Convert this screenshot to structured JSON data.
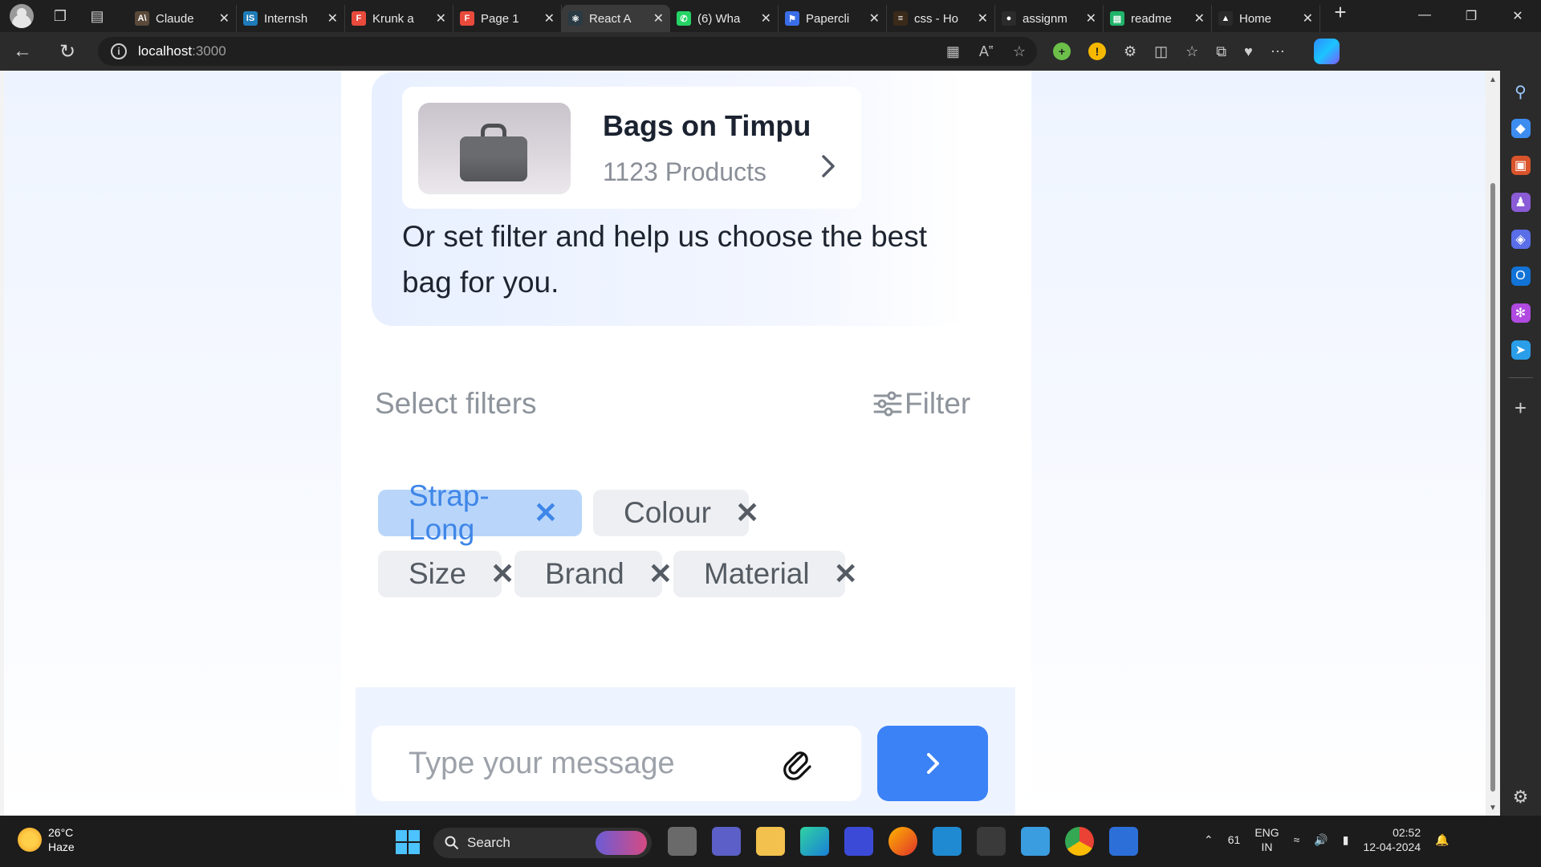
{
  "browser": {
    "tabs": [
      {
        "title": "Claude",
        "icon": "claude-icon",
        "color": "#5a4a3a",
        "glyph": "A\\"
      },
      {
        "title": "Internsh",
        "icon": "internshala-icon",
        "color": "#1e7bb8",
        "glyph": "IS"
      },
      {
        "title": "Krunk a",
        "icon": "figma-icon",
        "color": "#e84a3c",
        "glyph": "F"
      },
      {
        "title": "Page 1",
        "icon": "figma-icon",
        "color": "#e84a3c",
        "glyph": "F"
      },
      {
        "title": "React A",
        "icon": "react-icon",
        "color": "#2a3a44",
        "glyph": "⚛"
      },
      {
        "title": "(6) Wha",
        "icon": "whatsapp-icon",
        "color": "#25d366",
        "glyph": "✆"
      },
      {
        "title": "Papercli",
        "icon": "paperclip-flag-icon",
        "color": "#3a6ee8",
        "glyph": "⚑"
      },
      {
        "title": "css - Ho",
        "icon": "stackoverflow-icon",
        "color": "#3a2a1a",
        "glyph": "≡"
      },
      {
        "title": "assignm",
        "icon": "github-icon",
        "color": "#2b2b2b",
        "glyph": "●"
      },
      {
        "title": "readme",
        "icon": "sheet-icon",
        "color": "#20b36a",
        "glyph": "▤"
      },
      {
        "title": "Home",
        "icon": "drive-icon",
        "color": "#2a2a2a",
        "glyph": "▲"
      }
    ],
    "active_tab_index": 4,
    "url_host": "localhost",
    "url_port": ":3000"
  },
  "product": {
    "title": "Bags on Timpu",
    "count": "1123 Products",
    "image": "bag-image"
  },
  "bubble_text": "Or set filter and help us choose the best bag for you.",
  "filters": {
    "label": "Select filters",
    "button_label": "Filter",
    "chips": [
      {
        "label": "Strap-Long",
        "active": true
      },
      {
        "label": "Colour",
        "active": false
      },
      {
        "label": "Size",
        "active": false
      },
      {
        "label": "Brand",
        "active": false
      },
      {
        "label": "Material",
        "active": false
      }
    ]
  },
  "composer": {
    "placeholder": "Type your message"
  },
  "taskbar": {
    "weather_temp": "26°C",
    "weather_desc": "Haze",
    "search_label": "Search",
    "tray_number": "61",
    "lang_line1": "ENG",
    "lang_line2": "IN",
    "time": "02:52",
    "date": "12-04-2024"
  },
  "colors": {
    "accent": "#3b82f6",
    "chip_active_bg": "#b9d6fa",
    "chip_active_text": "#3f86e8"
  }
}
